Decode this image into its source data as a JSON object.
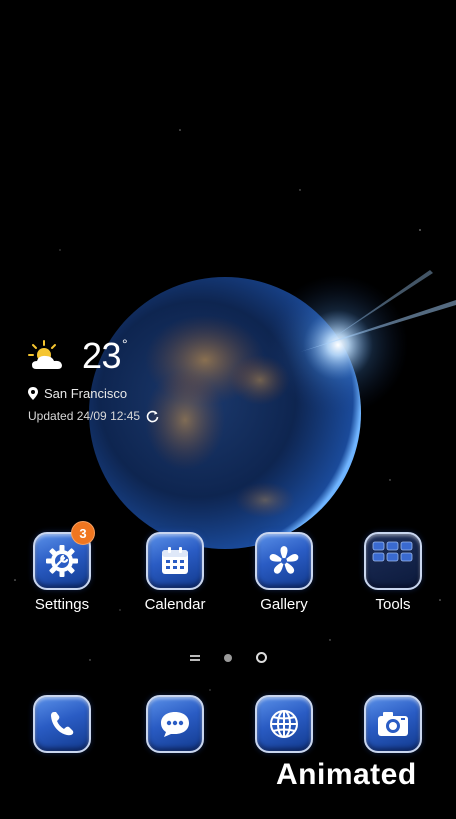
{
  "weather": {
    "temperature": "23",
    "degree_symbol": "°",
    "location": "San Francisco",
    "updated": "Updated 24/09 12:45",
    "icon": "partly-sunny-icon"
  },
  "apps": [
    {
      "label": "Settings",
      "icon": "gear-wrench-icon",
      "badge": "3"
    },
    {
      "label": "Calendar",
      "icon": "calendar-icon"
    },
    {
      "label": "Gallery",
      "icon": "pinwheel-flower-icon"
    },
    {
      "label": "Tools",
      "icon": "tools-folder-icon"
    }
  ],
  "dock": [
    {
      "icon": "phone-icon"
    },
    {
      "icon": "message-bubble-icon"
    },
    {
      "icon": "globe-icon"
    },
    {
      "icon": "camera-icon"
    }
  ],
  "pager": {
    "pages": 3,
    "current": 2
  },
  "watermark": "Animated",
  "colors": {
    "icon_blue": "#2a5cc4",
    "badge": "#f07620",
    "background": "#000000"
  }
}
